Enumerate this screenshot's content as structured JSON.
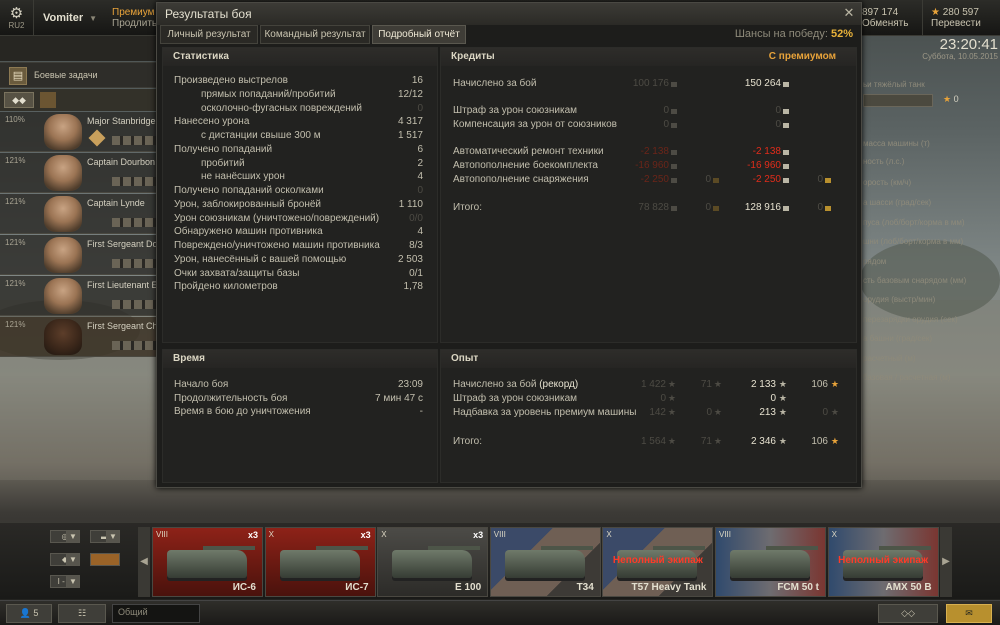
{
  "topbar": {
    "server_label": "RU2",
    "username": "Vomiter",
    "premium_label": "Премиум",
    "premium_extend": "Продлить",
    "gold_value": "897 174",
    "gold_action": "Обменять",
    "free_xp_value": "280 597",
    "free_xp_action": "Перевести"
  },
  "clock": {
    "time": "23:20:41",
    "date": "Суббота, 10.05.2015"
  },
  "left_panel": {
    "task_label": "Боевые задачи",
    "crew": [
      {
        "pct": "110%",
        "name": "Major Stanbridge"
      },
      {
        "pct": "121%",
        "name": "Captain Dourbon"
      },
      {
        "pct": "121%",
        "name": "Captain Lynde"
      },
      {
        "pct": "121%",
        "name": "First Sergeant Do"
      },
      {
        "pct": "121%",
        "name": "First Lieutenant E"
      },
      {
        "pct": "121%",
        "name": "First Sergeant Ch"
      }
    ]
  },
  "right_panel": {
    "header": "ьи тяжёлый танк",
    "value": "0",
    "lines": [
      "масса машины (т)",
      "ность (л.с.)",
      "орость (км/ч)",
      "а шасси (град/сек)",
      "пуса (лоб/борт/корма в мм)",
      "шни (лоб/борт/корма в мм)",
      "рядом",
      "сть базовым снарядом (мм)",
      "орудия (выстр/мин)",
      "перезарядки орудия (сек)",
      "а башни (град/сек)",
      "расчетный (м)",
      "базовая / расчетная (м)"
    ]
  },
  "window": {
    "title": "Результаты боя",
    "tabs": [
      "Личный результат",
      "Командный результат",
      "Подробный отчёт"
    ],
    "chance_label": "Шансы на победу:",
    "chance_value": "52%",
    "statistics": {
      "title": "Статистика",
      "rows": [
        {
          "label": "Произведено выстрелов",
          "value": "16",
          "indent": 0
        },
        {
          "label": "прямых попаданий/пробитий",
          "value": "12/12",
          "indent": 1
        },
        {
          "label": "осколочно-фугасных повреждений",
          "value": "0",
          "indent": 1,
          "dim": true
        },
        {
          "label": "Нанесено урона",
          "value": "4 317",
          "indent": 0
        },
        {
          "label": "с дистанции свыше 300 м",
          "value": "1 517",
          "indent": 1
        },
        {
          "label": "Получено попаданий",
          "value": "6",
          "indent": 0
        },
        {
          "label": "пробитий",
          "value": "2",
          "indent": 1
        },
        {
          "label": "не нанёсших урон",
          "value": "4",
          "indent": 1
        },
        {
          "label": "Получено попаданий осколками",
          "value": "0",
          "indent": 0,
          "dim": true
        },
        {
          "label": "Урон, заблокированный бронёй",
          "value": "1 110",
          "indent": 0
        },
        {
          "label": "Урон союзникам (уничтожено/повреждений)",
          "value": "0/0",
          "indent": 0,
          "dim": true
        },
        {
          "label": "Обнаружено машин противника",
          "value": "4",
          "indent": 0
        },
        {
          "label": "Повреждено/уничтожено машин противника",
          "value": "8/3",
          "indent": 0
        },
        {
          "label": "Урон, нанесённый с вашей помощью",
          "value": "2 503",
          "indent": 0
        },
        {
          "label": "Очки захвата/защиты базы",
          "value": "0/1",
          "indent": 0
        },
        {
          "label": "Пройдено километров",
          "value": "1,78",
          "indent": 0
        }
      ]
    },
    "credits": {
      "title": "Кредиты",
      "premium_label": "С премиумом",
      "rows": [
        {
          "label": "Начислено за бой",
          "base": "100 176",
          "prem": "150 264",
          "y": 0
        },
        {
          "label": "Штраф за урон союзникам",
          "base": "0",
          "prem": "0",
          "y": 1
        },
        {
          "label": "Компенсация за урон от союзников",
          "base": "0",
          "prem": "0",
          "y": 2
        },
        {
          "label": "Автоматический ремонт техники",
          "base": "-2 138",
          "prem": "-2 138",
          "y": 3,
          "neg": true
        },
        {
          "label": "Автопополнение боекомплекта",
          "base": "-16 960",
          "prem": "-16 960",
          "y": 4,
          "neg": true
        },
        {
          "label": "Автопополнение снаряжения",
          "base": "-2 250",
          "base_gold": "0",
          "prem": "-2 250",
          "prem_gold": "0",
          "y": 5,
          "neg": true
        }
      ],
      "total_label": "Итого:",
      "total_base": "78 828",
      "total_base_gold": "0",
      "total_prem": "128 916",
      "total_prem_gold": "0"
    },
    "time": {
      "title": "Время",
      "rows": [
        {
          "label": "Начало боя",
          "value": "23:09"
        },
        {
          "label": "Продолжительность боя",
          "value": "7 мин 47 с"
        },
        {
          "label": "Время в бою до уничтожения",
          "value": "-"
        }
      ]
    },
    "experience": {
      "title": "Опыт",
      "rows": [
        {
          "label_main": "Начислено за бой",
          "label_extra": "(рекорд)",
          "base": "1 422",
          "base_free": "71",
          "prem": "2 133",
          "prem_free": "106"
        },
        {
          "label_main": "Штраф за урон союзникам",
          "label_extra": "",
          "base": "0",
          "base_free": "",
          "prem": "0",
          "prem_free": ""
        },
        {
          "label_main": "Надбавка за уровень премиум машины",
          "label_extra": "",
          "base": "142",
          "base_free": "0",
          "prem": "213",
          "prem_free": "0"
        }
      ],
      "total_label": "Итого:",
      "total_base": "1 564",
      "total_base_free": "71",
      "total_prem": "2 346",
      "total_prem_free": "106"
    }
  },
  "carousel": {
    "filter_tier": "I - X",
    "tanks": [
      {
        "tier": "VIII",
        "x3": "x3",
        "name": "ИС-6",
        "style": "red",
        "crewless": ""
      },
      {
        "tier": "X",
        "x3": "x3",
        "name": "ИС-7",
        "style": "red",
        "crewless": ""
      },
      {
        "tier": "X",
        "x3": "x3",
        "name": "E 100",
        "style": "grey",
        "crewless": ""
      },
      {
        "tier": "VIII",
        "x3": "",
        "name": "T34",
        "style": "us",
        "crewless": ""
      },
      {
        "tier": "X",
        "x3": "",
        "name": "T57 Heavy Tank",
        "style": "us",
        "crewless": "Неполный экипаж"
      },
      {
        "tier": "VIII",
        "x3": "",
        "name": "FCM 50 t",
        "style": "fr",
        "crewless": ""
      },
      {
        "tier": "X",
        "x3": "",
        "name": "AMX 50 B",
        "style": "fr",
        "crewless": "Неполный экипаж"
      }
    ]
  },
  "bottombar": {
    "squad_count": "5",
    "chat_label": "Общий"
  }
}
